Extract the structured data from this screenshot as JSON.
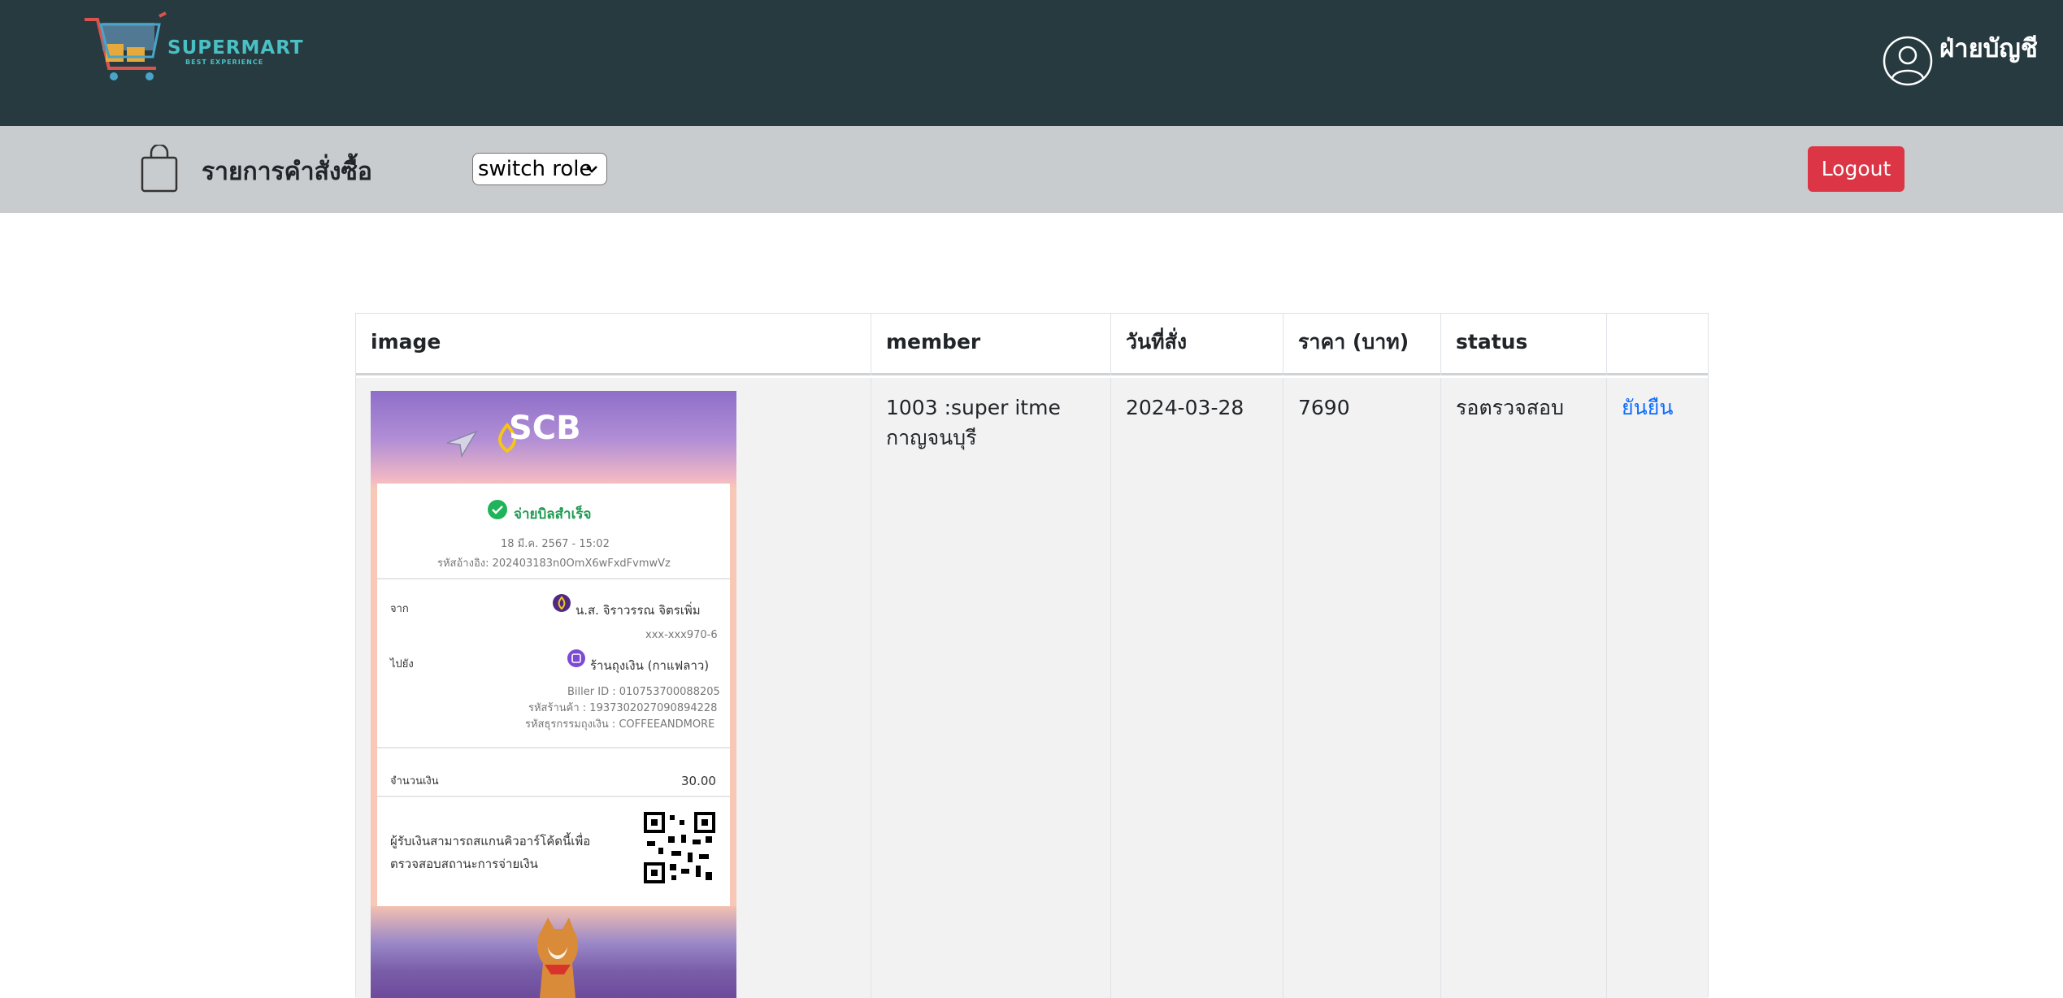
{
  "header": {
    "brand": "SUPERMART",
    "tagline": "BEST EXPERIENCE",
    "user_role": "ฝ่ายบัญชี"
  },
  "toolbar": {
    "title": "รายการคำสั่งซื้อ",
    "role_select_value": "switch role",
    "logout_label": "Logout"
  },
  "table": {
    "columns": [
      "image",
      "member",
      "วันที่สั่ง",
      "ราคา (บาท)",
      "status",
      ""
    ],
    "rows": [
      {
        "member": "1003 :super itme กาญจนบุรี",
        "order_date": "2024-03-28",
        "price": "7690",
        "status": "รอตรวจสอบ",
        "action": "ยันยืน",
        "slip": {
          "bank": "SCB",
          "result": "จ่ายบิลสำเร็จ",
          "datetime": "18 มี.ค. 2567 - 15:02",
          "ref": "รหัสอ้างอิง: 202403183n0OmX6wFxdFvmwVz",
          "from_label": "จาก",
          "from_name": "น.ส. จิราวรรณ จิตรเพิ่ม",
          "from_account": "xxx-xxx970-6",
          "to_label": "ไปยัง",
          "to_name": "ร้านถุงเงิน (กาแฟลาว)",
          "biller_id": "Biller ID : 010753700088205",
          "shop_code": "รหัสร้านค้า : 193730202709089422​8",
          "txn_code": "รหัสธุรกรรมถุงเงิน : COFFEEANDMORE",
          "amount_label": "จำนวนเงิน",
          "amount": "30.00",
          "qr_note_1": "ผู้รับเงินสามารถสแกนคิวอาร์โค้ดนี้เพื่อ",
          "qr_note_2": "ตรวจสอบสถานะการจ่ายเงิน"
        }
      }
    ]
  },
  "colors": {
    "topbar": "#263a40",
    "subbar": "#c8ccce",
    "logout": "#dc3545",
    "link": "#0d6efd",
    "row_bg": "#f2f2f2"
  }
}
